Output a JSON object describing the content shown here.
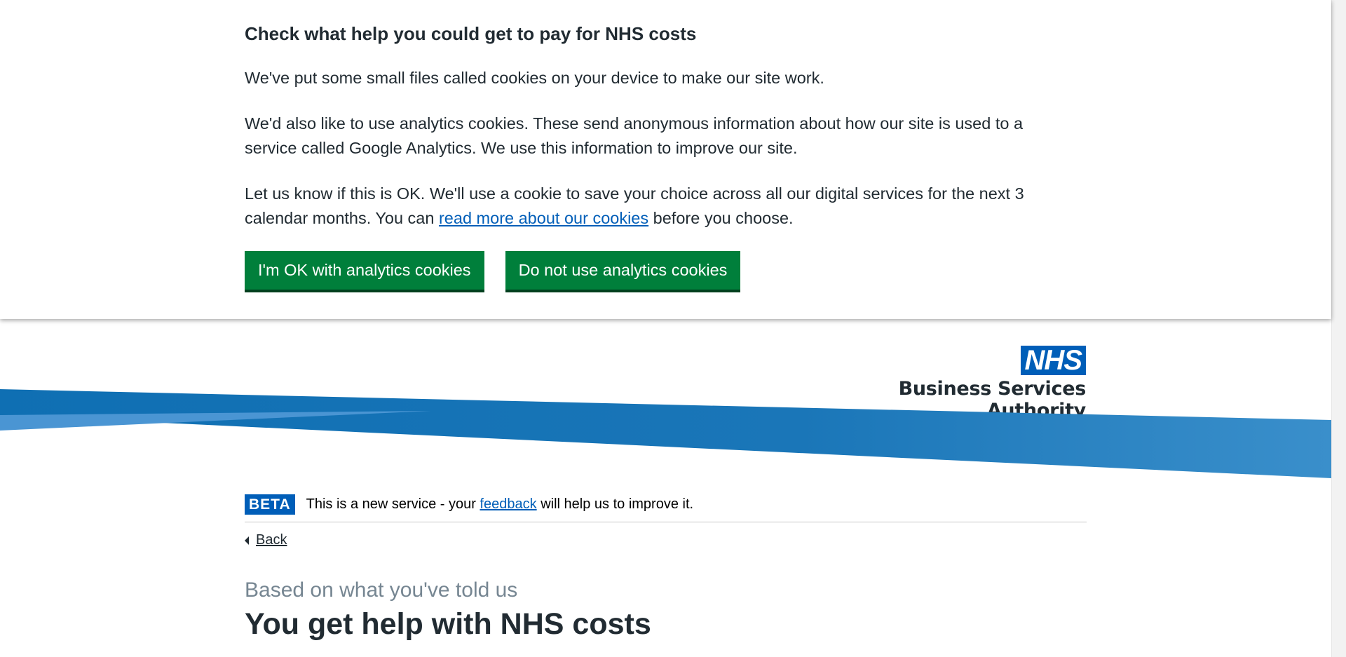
{
  "cookie_banner": {
    "title": "Check what help you could get to pay for NHS costs",
    "p1": "We've put some small files called cookies on your device to make our site work.",
    "p2": "We'd also like to use analytics cookies. These send anonymous information about how our site is used to a service called Google Analytics. We use this information to improve our site.",
    "p3_line1": "Let us know if this is OK. We'll use a cookie to save your choice across all our digital services for the next 3",
    "p3_line2_before": "calendar months. You can ",
    "p3_link": "read more about our cookies",
    "p3_line2_after": " before you choose.",
    "accept_button": "I'm OK with analytics cookies",
    "reject_button": "Do not use analytics cookies",
    "button_color": "#007f3b"
  },
  "header": {
    "logo_text": "NHS",
    "org_name": "Business Services Authority",
    "brand_color": "#005eb8"
  },
  "phase_banner": {
    "tag": "BETA",
    "text_before": "This is a new service - your ",
    "link": "feedback",
    "text_after": " will help us to improve it."
  },
  "back_link": "Back",
  "main": {
    "caption": "Based on what you've told us",
    "heading": "You get help with NHS costs"
  }
}
